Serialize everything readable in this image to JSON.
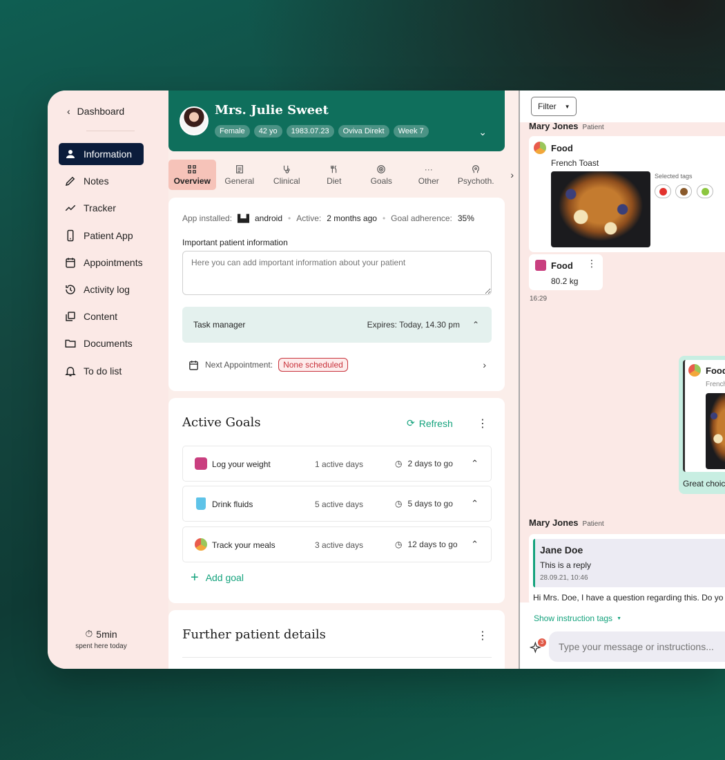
{
  "sidebar": {
    "back_label": "Dashboard",
    "items": [
      {
        "label": "Information"
      },
      {
        "label": "Notes"
      },
      {
        "label": "Tracker"
      },
      {
        "label": "Patient App"
      },
      {
        "label": "Appointments"
      },
      {
        "label": "Activity log"
      },
      {
        "label": "Content"
      },
      {
        "label": "Documents"
      },
      {
        "label": "To do list"
      }
    ],
    "timer": {
      "value": "5min",
      "caption": "spent here today"
    }
  },
  "header": {
    "name": "Mrs. Julie Sweet",
    "chips": [
      "Female",
      "42 yo",
      "1983.07.23",
      "Oviva Direkt",
      "Week 7"
    ]
  },
  "tabs": [
    {
      "label": "Overview"
    },
    {
      "label": "General"
    },
    {
      "label": "Clinical"
    },
    {
      "label": "Diet"
    },
    {
      "label": "Goals"
    },
    {
      "label": "Other"
    },
    {
      "label": "Psychoth."
    }
  ],
  "overview": {
    "app_installed_label": "App installed:",
    "app_installed_value": "android",
    "active_label": "Active:",
    "active_value": "2 months ago",
    "adherence_label": "Goal adherence:",
    "adherence_value": "35%",
    "important_label": "Important patient information",
    "important_placeholder": "Here you can add important information about your patient",
    "task_label": "Task manager",
    "task_expires": "Expires: Today, 14.30 pm",
    "next_appt_label": "Next Appointment:",
    "next_appt_value": "None scheduled"
  },
  "goals": {
    "title": "Active Goals",
    "refresh_label": "Refresh",
    "items": [
      {
        "name": "Log your weight",
        "days": "1 active days",
        "to_go": "2 days to go"
      },
      {
        "name": "Drink fluids",
        "days": "5 active days",
        "to_go": "5 days to go"
      },
      {
        "name": "Track your meals",
        "days": "3 active days",
        "to_go": "12 days to go"
      }
    ],
    "add_label": "Add goal"
  },
  "further": {
    "title": "Further patient details"
  },
  "chat": {
    "filter_label": "Filter",
    "sender1": {
      "name": "Mary Jones",
      "role": "Patient"
    },
    "food_msg": {
      "title": "Food",
      "subtitle": "French Toast",
      "tags_label": "Selected tags"
    },
    "weight_msg": {
      "title": "Food",
      "value": "80.2 kg"
    },
    "time1": "16:29",
    "green_msg": {
      "title": "Food",
      "subtitle": "French",
      "caption": "Great choic"
    },
    "sender2": {
      "name": "Mary Jones",
      "role": "Patient"
    },
    "reply": {
      "author": "Jane Doe",
      "text": "This is a reply",
      "time": "28.09.21, 10:46",
      "message": "Hi Mrs. Doe, I have a question regarding this. Do yo"
    },
    "instruction_tags": "Show instruction tags",
    "ai_badge": "3",
    "input_placeholder": "Type your message or instructions..."
  },
  "colors": {
    "brand": "#0f6f5c",
    "accent": "#13a27c",
    "nav_active": "#0b1c3b",
    "alert": "#c9323b"
  }
}
